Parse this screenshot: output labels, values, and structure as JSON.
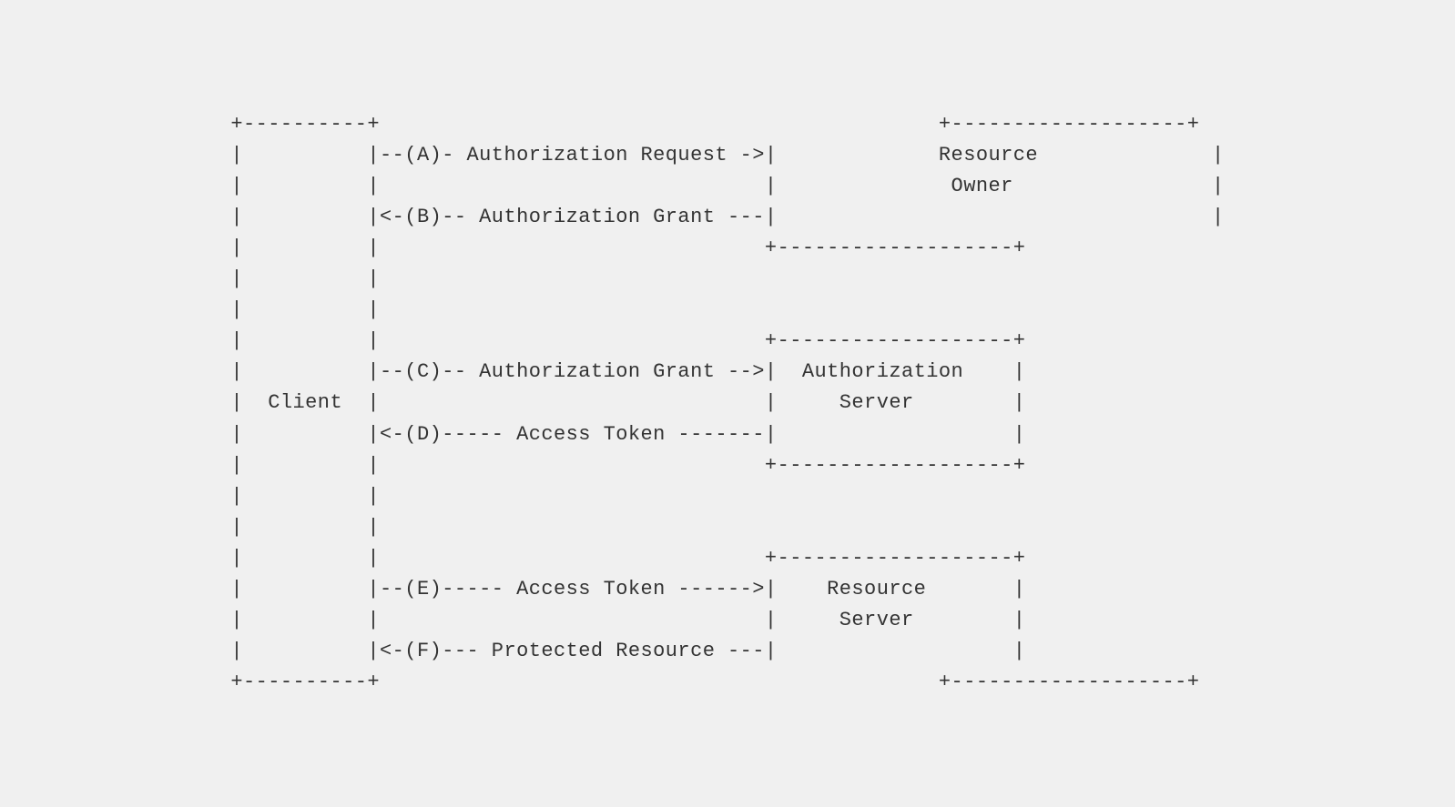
{
  "diagram": {
    "lines": [
      "+----------+                                             +-------------------+",
      "|          |--(A)- Authorization Request ->|            Resource            |",
      "|          |                               |             Owner              |",
      "|          |<-(B)-- Authorization Grant ---|                                |",
      "|          |                               +-------------------+",
      "|          |",
      "|          |",
      "|          |                               +-------------------+",
      "|          |--(C)-- Authorization Grant -->|  Authorization    |",
      "|  Client  |                               |     Server        |",
      "|          |<-(D)----- Access Token -------|                   |",
      "|          |                               +-------------------+",
      "|          |",
      "|          |",
      "|          |                               +-------------------+",
      "|          |--(E)----- Access Token ------>|    Resource       |",
      "|          |                               |     Server        |",
      "|          |<-(F)--- Protected Resource ---|                   |",
      "+----------+                                             +-------------------+"
    ],
    "content": "+----------+                                             +-------------------+\n|          |--(A)- Authorization Request ->|             Resource              |\n|          |                               |              Owner                |\n|          |<-(B)-- Authorization Grant ---|                                   |\n|          |                               +-------------------+\n|          |\n|          |\n|          |                               +-------------------+\n|          |--(C)-- Authorization Grant -->|  Authorization    |\n|  Client  |                               |     Server        |\n|          |<-(D)----- Access Token -------|                   |\n|          |                               +-------------------+\n|          |\n|          |\n|          |                               +-------------------+\n|          |--(E)----- Access Token ------>|    Resource       |\n|          |                               |     Server        |\n|          |<-(F)--- Protected Resource ---|                   |\n+----------+                                             +-------------------+"
  }
}
